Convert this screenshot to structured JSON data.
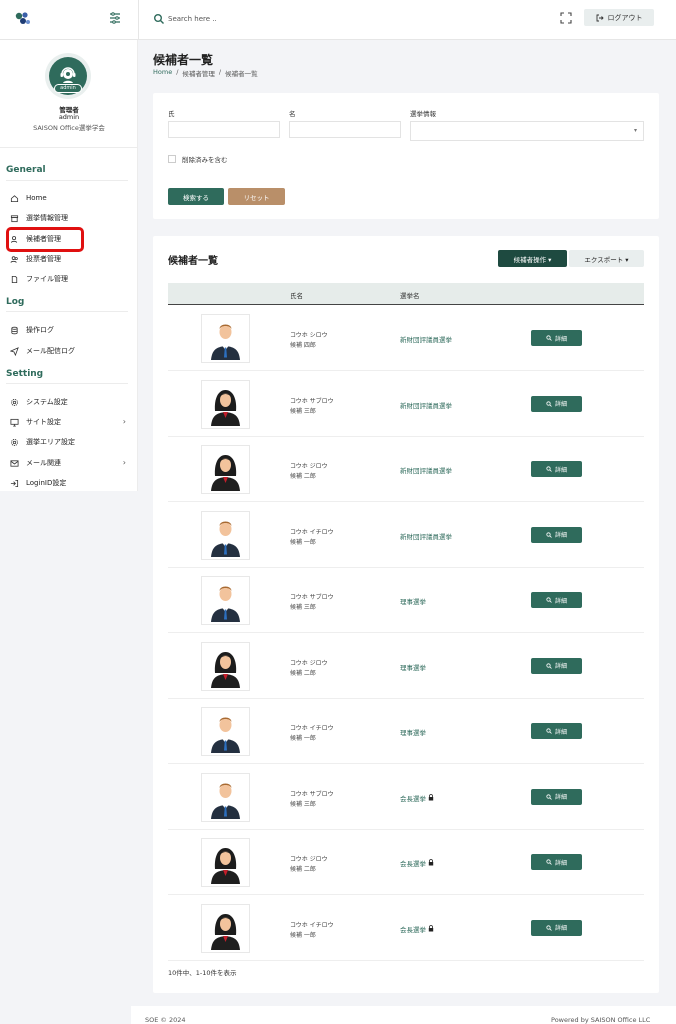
{
  "header": {
    "search_placeholder": "Search here ..",
    "logout_label": "ログアウト"
  },
  "profile": {
    "badge": "admin",
    "role": "管理者",
    "username": "admin",
    "org": "SAISON Office選挙学会"
  },
  "sidebar": {
    "sections": [
      {
        "title": "General",
        "items": [
          {
            "label": "Home",
            "icon": "home-icon"
          },
          {
            "label": "選挙情報管理",
            "icon": "archive-icon"
          },
          {
            "label": "候補者管理",
            "icon": "user-icon",
            "active": true
          },
          {
            "label": "投票者管理",
            "icon": "users-icon"
          },
          {
            "label": "ファイル管理",
            "icon": "file-icon"
          }
        ]
      },
      {
        "title": "Log",
        "items": [
          {
            "label": "操作ログ",
            "icon": "database-icon"
          },
          {
            "label": "メール配信ログ",
            "icon": "send-icon"
          }
        ]
      },
      {
        "title": "Setting",
        "items": [
          {
            "label": "システム設定",
            "icon": "gear-icon"
          },
          {
            "label": "サイト設定",
            "icon": "monitor-icon",
            "chevron": "›"
          },
          {
            "label": "選挙エリア設定",
            "icon": "gear-icon"
          },
          {
            "label": "メール関連",
            "icon": "mail-icon",
            "chevron": "›"
          },
          {
            "label": "LoginID設定",
            "icon": "login-icon"
          }
        ]
      }
    ]
  },
  "page": {
    "title": "候補者一覧",
    "breadcrumbs": [
      "Home",
      "候補者管理",
      "候補者一覧"
    ]
  },
  "filter": {
    "last_name_label": "氏",
    "first_name_label": "名",
    "election_label": "選挙情報",
    "include_deleted_label": "削除済みを含む",
    "search_label": "検索する",
    "reset_label": "リセット"
  },
  "list": {
    "title": "候補者一覧",
    "ops_label": "候補者操作 ▾",
    "export_label": "エクスポート ▾",
    "columns": [
      "氏名",
      "選挙名"
    ],
    "detail_label": "詳細",
    "rows": [
      {
        "kana": "コウホ シロウ",
        "name": "候補 四郎",
        "election": "新財団評議員選挙",
        "locked": false,
        "gender": "male"
      },
      {
        "kana": "コウホ サブロウ",
        "name": "候補 三郎",
        "election": "新財団評議員選挙",
        "locked": false,
        "gender": "female"
      },
      {
        "kana": "コウホ ジロウ",
        "name": "候補 二郎",
        "election": "新財団評議員選挙",
        "locked": false,
        "gender": "female"
      },
      {
        "kana": "コウホ イチロウ",
        "name": "候補 一郎",
        "election": "新財団評議員選挙",
        "locked": false,
        "gender": "male"
      },
      {
        "kana": "コウホ サブロウ",
        "name": "候補 三郎",
        "election": "理事選挙",
        "locked": false,
        "gender": "male"
      },
      {
        "kana": "コウホ ジロウ",
        "name": "候補 二郎",
        "election": "理事選挙",
        "locked": false,
        "gender": "female"
      },
      {
        "kana": "コウホ イチロウ",
        "name": "候補 一郎",
        "election": "理事選挙",
        "locked": false,
        "gender": "male"
      },
      {
        "kana": "コウホ サブロウ",
        "name": "候補 三郎",
        "election": "会長選挙",
        "locked": true,
        "gender": "male"
      },
      {
        "kana": "コウホ ジロウ",
        "name": "候補 二郎",
        "election": "会長選挙",
        "locked": true,
        "gender": "female"
      },
      {
        "kana": "コウホ イチロウ",
        "name": "候補 一郎",
        "election": "会長選挙",
        "locked": true,
        "gender": "female"
      }
    ],
    "summary": "10件中、1-10件を表示"
  },
  "footer": {
    "left": "SOE © 2024",
    "right": "Powered by SAISON Office LLC"
  },
  "colors": {
    "accent": "#2f6b5c",
    "reset": "#b98f69",
    "highlight": "#e01010"
  }
}
